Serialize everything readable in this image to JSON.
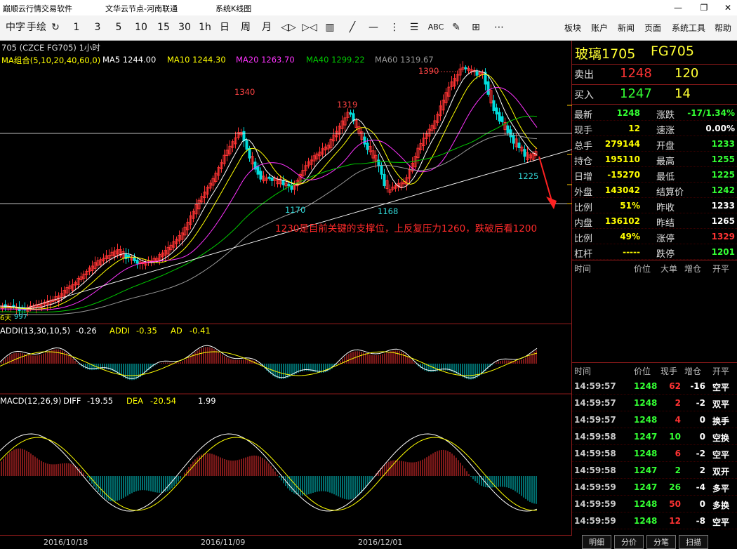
{
  "window": {
    "title": "巅顺云行情交易软件",
    "node": "文华云节点-河南联通",
    "section": "系统K线图",
    "controls": [
      "—",
      "❐",
      "✕"
    ]
  },
  "toolbar": {
    "tools": [
      "中字",
      "手绘",
      "↻",
      "1",
      "3",
      "5",
      "10",
      "15",
      "30",
      "1h",
      "日",
      "周",
      "月",
      "◁▷",
      "▷◁",
      "▥",
      "╱",
      "—",
      "⋮",
      "☰",
      "ABC",
      "✎",
      "⊞",
      "⋯"
    ],
    "menus": [
      "板块",
      "账户",
      "新闻",
      "页面",
      "系统工具",
      "帮助"
    ]
  },
  "chart": {
    "header": "705 (CZCE FG705) 1小时",
    "ma_name": "MA组合(5,10,20,40,60,0)",
    "ma5": "MA5 1244.00",
    "ma10": "MA10 1244.30",
    "ma20": "MA20 1263.70",
    "ma40": "MA40 1299.22",
    "ma60": "MA60 1319.67",
    "colors": {
      "ma5": "#ffffff",
      "ma10": "#ffff00",
      "ma20": "#ff33ff",
      "ma40": "#00cc00",
      "ma60": "#999999",
      "up": "#ff3333",
      "down": "#00dddd"
    },
    "price_labels": {
      "p1390": "1390",
      "p1340": "1340",
      "p1319": "1319",
      "p1170": "1170",
      "p1168": "1168",
      "p1225": "1225",
      "p997": "997",
      "days": "6天"
    },
    "annotation": "1230是目前关键的支撑位，上反复压力1260，跌破后看1200",
    "addi_header": "ADDI(13,30,10,5)",
    "addi_val": "-0.26",
    "addi_label": "ADDI",
    "addi_v2": "-0.35",
    "ad_label": "AD",
    "ad_val": "-0.41",
    "macd_header": "MACD(12,26,9)",
    "diff_label": "DIFF",
    "diff_val": "-19.55",
    "dea_label": "DEA",
    "dea_val": "-20.54",
    "macd_val": "1.99"
  },
  "dates": [
    "2016/10/18",
    "2016/11/09",
    "2016/12/01"
  ],
  "quote": {
    "name": "玻璃1705",
    "code": "FG705",
    "sell_label": "卖出",
    "sell_price": "1248",
    "sell_vol": "120",
    "buy_label": "买入",
    "buy_price": "1247",
    "buy_vol": "14",
    "stats": [
      {
        "l1": "最新",
        "v1": "1248",
        "c1": "#33ff33",
        "l2": "涨跌",
        "v2": "-17/1.34%",
        "c2": "#33ff33"
      },
      {
        "l1": "现手",
        "v1": "12",
        "c1": "#ffff00",
        "l2": "速涨",
        "v2": "0.00%",
        "c2": "#ffffff"
      },
      {
        "l1": "总手",
        "v1": "279144",
        "c1": "#ffff00",
        "l2": "开盘",
        "v2": "1233",
        "c2": "#33ff33"
      },
      {
        "l1": "持仓",
        "v1": "195110",
        "c1": "#ffff00",
        "l2": "最高",
        "v2": "1255",
        "c2": "#33ff33"
      },
      {
        "l1": "日增",
        "v1": "-15270",
        "c1": "#ffff00",
        "l2": "最低",
        "v2": "1225",
        "c2": "#33ff33"
      },
      {
        "l1": "外盘",
        "v1": "143042",
        "c1": "#ffff00",
        "l2": "结算价",
        "v2": "1242",
        "c2": "#33ff33"
      },
      {
        "l1": "比例",
        "v1": "51%",
        "c1": "#ffff00",
        "l2": "昨收",
        "v2": "1233",
        "c2": "#ffffff"
      },
      {
        "l1": "内盘",
        "v1": "136102",
        "c1": "#ffff00",
        "l2": "昨结",
        "v2": "1265",
        "c2": "#ffffff"
      },
      {
        "l1": "比例",
        "v1": "49%",
        "c1": "#ffff00",
        "l2": "涨停",
        "v2": "1329",
        "c2": "#ff3333"
      },
      {
        "l1": "杠杆",
        "v1": "-----",
        "c1": "#ffff00",
        "l2": "跌停",
        "v2": "1201",
        "c2": "#33ff33"
      }
    ],
    "large_headers": [
      "时间",
      "价位",
      "大单",
      "增仓",
      "开平"
    ],
    "tick_headers": [
      "时间",
      "价位",
      "现手",
      "增仓",
      "开平"
    ],
    "ticks": [
      {
        "time": "14:59:57",
        "price": "1248",
        "vol": "62",
        "vc": "#ff3333",
        "chg": "-16",
        "type": "空平"
      },
      {
        "time": "14:59:57",
        "price": "1248",
        "vol": "2",
        "vc": "#ff3333",
        "chg": "-2",
        "type": "双平"
      },
      {
        "time": "14:59:57",
        "price": "1248",
        "vol": "4",
        "vc": "#ff3333",
        "chg": "0",
        "type": "换手"
      },
      {
        "time": "14:59:58",
        "price": "1247",
        "vol": "10",
        "vc": "#33ff33",
        "chg": "0",
        "type": "空换"
      },
      {
        "time": "14:59:58",
        "price": "1248",
        "vol": "6",
        "vc": "#ff3333",
        "chg": "-2",
        "type": "空平"
      },
      {
        "time": "14:59:58",
        "price": "1247",
        "vol": "2",
        "vc": "#33ff33",
        "chg": "2",
        "type": "双开"
      },
      {
        "time": "14:59:59",
        "price": "1247",
        "vol": "26",
        "vc": "#33ff33",
        "chg": "-4",
        "type": "多平"
      },
      {
        "time": "14:59:59",
        "price": "1248",
        "vol": "50",
        "vc": "#ff3333",
        "chg": "0",
        "type": "多换"
      },
      {
        "time": "14:59:59",
        "price": "1248",
        "vol": "12",
        "vc": "#ff3333",
        "chg": "-8",
        "type": "空平"
      }
    ],
    "tabs": [
      "明细",
      "分价",
      "分笔",
      "扫描"
    ]
  }
}
